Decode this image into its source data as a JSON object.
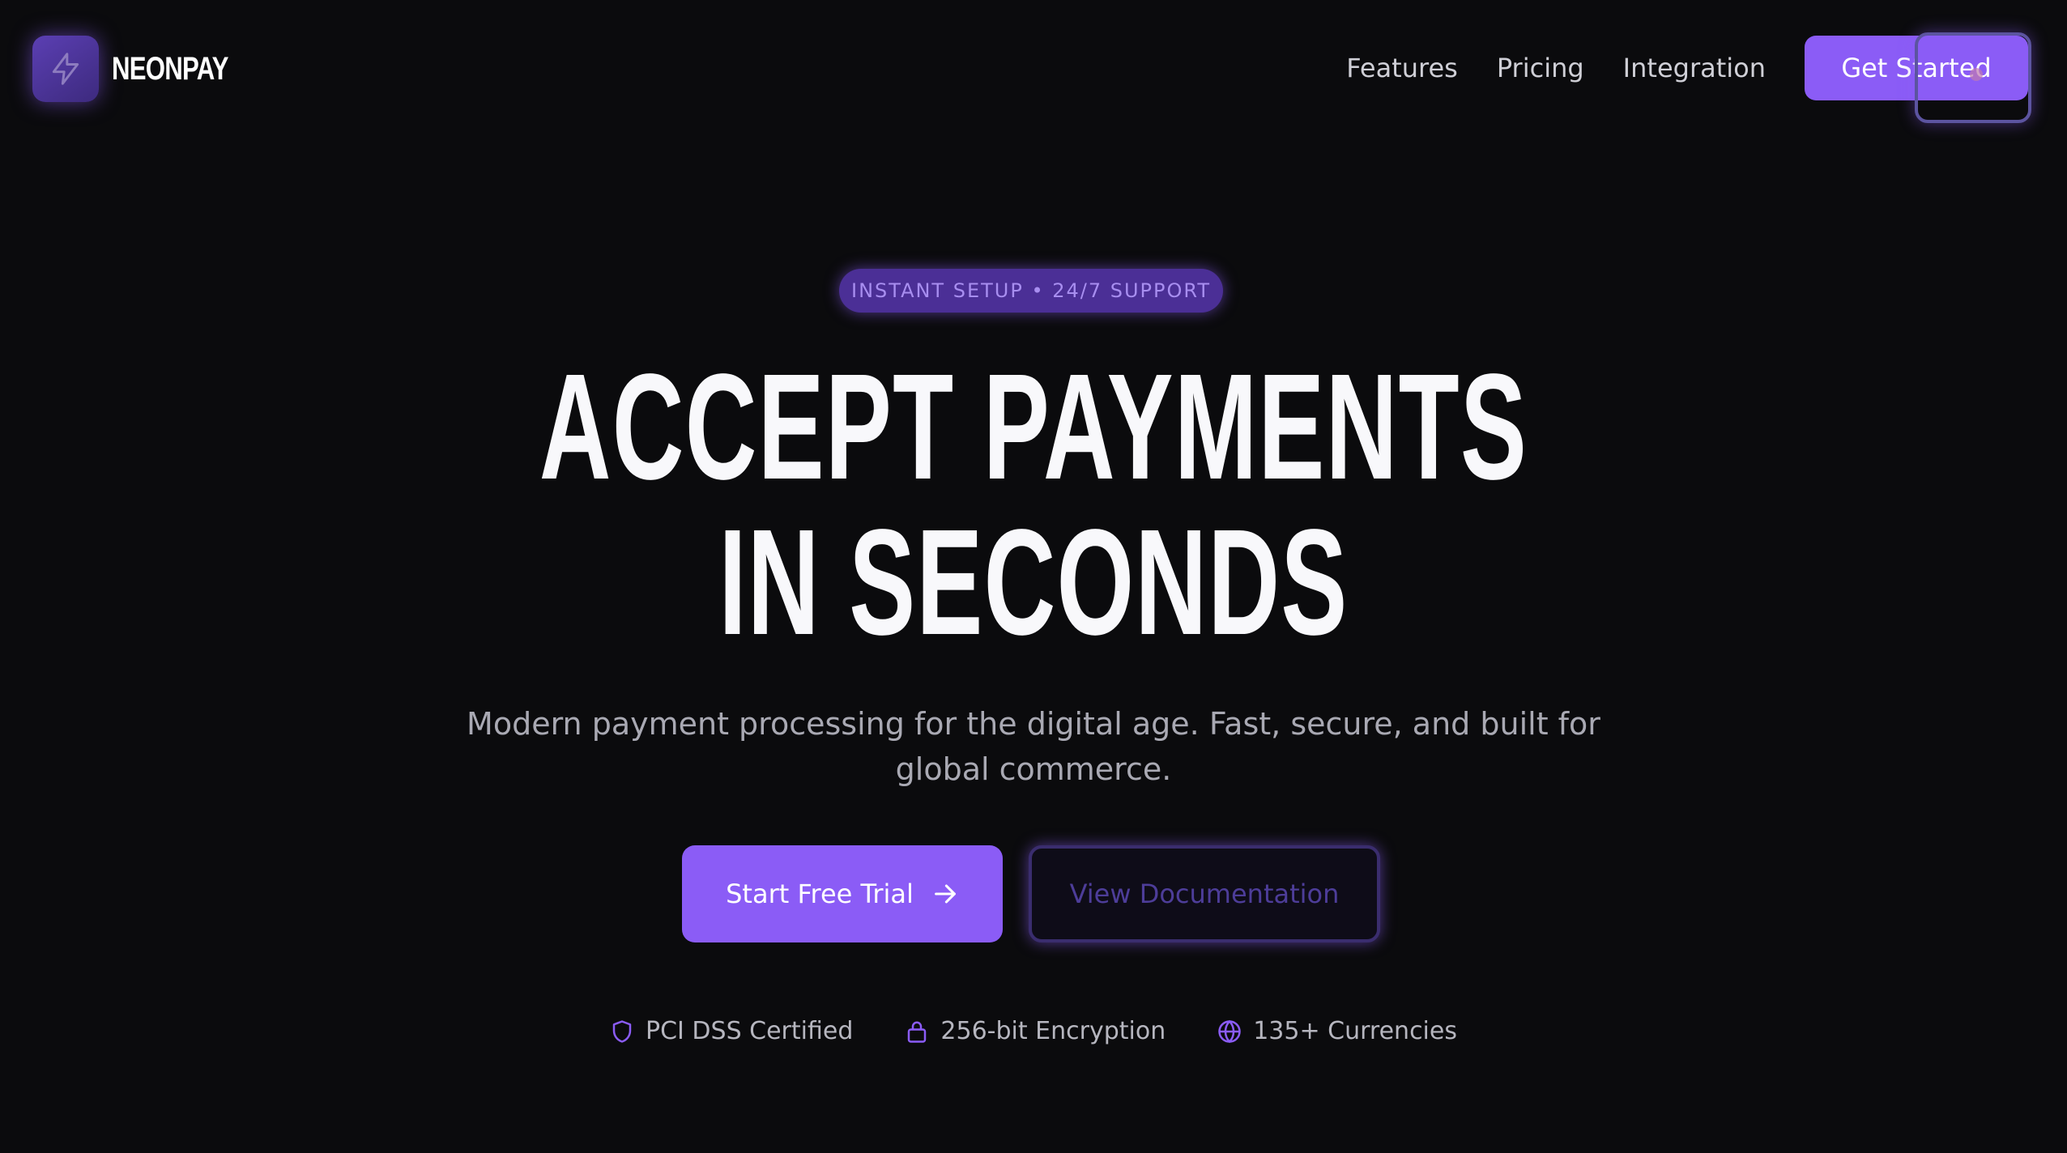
{
  "brand": {
    "name": "NEONPAY",
    "icon": "lightning-bolt-icon"
  },
  "nav": {
    "links": [
      "Features",
      "Pricing",
      "Integration"
    ],
    "cta_label": "Get Started"
  },
  "hero": {
    "badge": "INSTANT SETUP • 24/7 SUPPORT",
    "headline_line1": "ACCEPT PAYMENTS",
    "headline_line2": "IN SECONDS",
    "subtitle": "Modern payment processing for the digital age. Fast, secure, and built for global commerce.",
    "primary_button": "Start Free Trial",
    "primary_button_icon": "arrow-right-icon",
    "secondary_button": "View Documentation"
  },
  "trust": [
    {
      "icon": "shield-icon",
      "label": "PCI DSS Certified"
    },
    {
      "icon": "lock-icon",
      "label": "256-bit Encryption"
    },
    {
      "icon": "globe-icon",
      "label": "135+ Currencies"
    }
  ],
  "colors": {
    "background": "#0b0b0d",
    "accent": "#8b5cf6",
    "badge_bg": "#4b2f96",
    "text_muted": "#a9a9b3"
  }
}
